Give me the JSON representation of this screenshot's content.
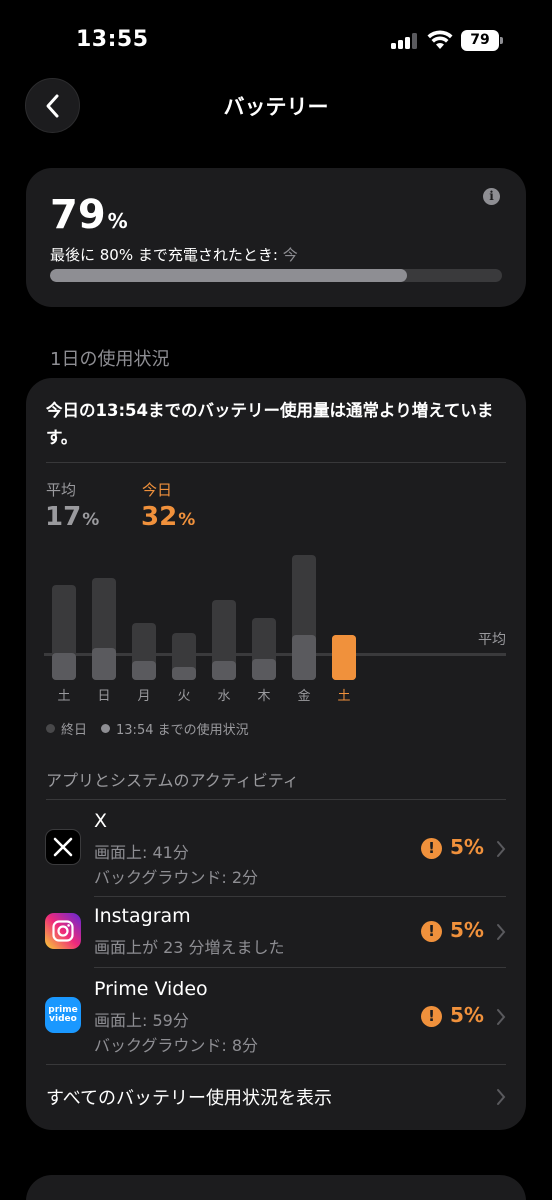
{
  "status_bar": {
    "time": "13:55",
    "battery": "79"
  },
  "nav": {
    "title": "バッテリー"
  },
  "battery_card": {
    "percent": "79",
    "percent_unit": "%",
    "last_charged_label": "最後に 80% まで充電されたとき:",
    "last_charged_value": "今",
    "level_fraction": 0.79
  },
  "section": {
    "daily_usage": "1日の使用状況"
  },
  "usage_card": {
    "headline": "今日の13:54までのバッテリー使用量は通常より増えています。",
    "average_label": "平均",
    "average_value": "17",
    "today_label": "今日",
    "today_value": "32",
    "unit": "%",
    "avg_line_label": "平均",
    "legend": {
      "all_day": "終日",
      "until_now": "13:54 までの使用状況"
    },
    "apps_title": "アプリとシステムのアクティビティ",
    "apps": [
      {
        "name": "X",
        "line1": "画面上: 41分",
        "line2": "バックグラウンド: 2分",
        "pct": "5%"
      },
      {
        "name": "Instagram",
        "line1": "画面上が 23 分増えました",
        "line2": "",
        "pct": "5%"
      },
      {
        "name": "Prime Video",
        "line1": "画面上: 59分",
        "line2": "バックグラウンド: 8分",
        "pct": "5%",
        "icon_text_1": "prime",
        "icon_text_2": "video"
      }
    ],
    "show_all": "すべてのバッテリー使用状況を表示"
  },
  "colors": {
    "accent": "#f0913c",
    "card": "#1c1c1e",
    "muted": "#8e8e93"
  },
  "chart_data": {
    "type": "bar",
    "categories": [
      "土",
      "日",
      "月",
      "火",
      "水",
      "木",
      "金",
      "土"
    ],
    "series": [
      {
        "values": [
          50,
          54,
          30,
          25,
          42,
          33,
          66,
          24
        ]
      },
      {
        "values": [
          14,
          17,
          10,
          7,
          10,
          11,
          24,
          24
        ]
      }
    ],
    "highlight_index": 7,
    "average": 17,
    "ylim": [
      0,
      70
    ],
    "legend_placement": "bottom-left"
  }
}
